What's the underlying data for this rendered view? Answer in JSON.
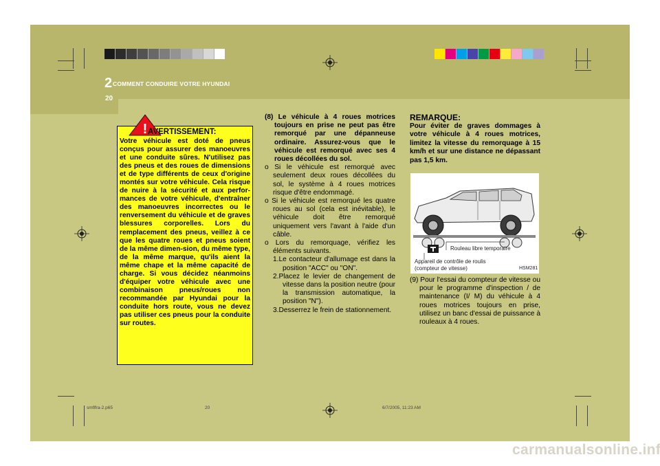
{
  "header": {
    "chapter_number": "2",
    "chapter_title": "COMMENT CONDUIRE VOTRE HYUNDAI",
    "page_number": "20"
  },
  "colors": {
    "page_background": "#c9c882",
    "header_band": "#b8b66a",
    "warning_box": "#ffff1e",
    "text": "#000000",
    "watermark": "#d8d4c8"
  },
  "swatches_gray": [
    "#1a1a1a",
    "#2c2c2c",
    "#3f3f3f",
    "#535353",
    "#686868",
    "#7d7d7d",
    "#939393",
    "#a9a9a9",
    "#c0c0c0",
    "#d8d8d8",
    "#ffffff"
  ],
  "swatches_color": [
    "#ffe600",
    "#e4007f",
    "#00a0e9",
    "#4a43a8",
    "#009944",
    "#e60012",
    "#ffec3a",
    "#f5a8c8",
    "#7fc9ef",
    "#a99fd1"
  ],
  "warning": {
    "icon": "warning-triangle-icon",
    "title": "AVERTISSEMENT:",
    "text": "Votre véhicule est doté de pneus conçus pour assurer des manoeuvres et une conduite sûres. N'utilisez pas des pneus et des roues de dimensions et de type différents de ceux d'origine montés sur votre véhicule. Cela risque de nuire à la sécurité et aux perfor-mances de votre véhicule, d'entraîner des manoeuvres incorrectes ou le renversement du véhicule et de graves blessures corporelles. Lors du remplacement des pneus, veillez à ce que les quatre roues et pneus soient de la même dimen-sion, du même type, de la même marque, qu'ils aient la même chape et la même capacité de charge. Si vous décidez néanmoins d'équiper votre véhicule avec une combinaison pneus/roues non recommandée par Hyundai pour la conduite hors route, vous ne devez pas utiliser ces pneus pour la conduite sur routes."
  },
  "step8": {
    "heading": "(8) Le véhicule à 4 roues motrices toujours en prise ne peut pas être remorqué par une dépanneuse ordinaire. Assurez-vous que le véhicule est remorqué avec ses 4 roues décollées du sol.",
    "bullets": [
      "o Si le véhicule est remorqué avec seulement deux roues décollées du sol, le système à 4 roues motrices risque d'être endommagé.",
      "o Si le véhicule est remorqué les quatre roues au sol (cela est inévitable), le véhicule doit être remorqué uniquement vers l'avant à l'aide d'un câble.",
      "o Lors du remorquage, vérifiez les éléments suivants."
    ],
    "substeps": [
      "1.Le contacteur d'allumage est dans la position \"ACC\" ou \"ON\".",
      "2.Placez le levier de changement de vitesse dans la position neutre (pour la transmission automatique, la position \"N\").",
      "3.Desserrez le frein de stationnement."
    ]
  },
  "note": {
    "title": "REMARQUE:",
    "text": "Pour éviter de graves dommages à votre véhicule à 4 roues motrices, limitez la vitesse du remorquage à 15 km/h et sur une distance ne dépassant pas 1,5 km."
  },
  "figure": {
    "label_roller": "Rouleau libre temporaire",
    "label_dyno_line1": "Appareil de contrôle de roulis",
    "label_dyno_line2": "(compteur de vitesse)",
    "code": "HSM281"
  },
  "step9": {
    "text": "(9) Pour l'essai du compteur de vitesse ou pour le programme d'inspection / de maintenance (I/ M) du véhicule à 4 roues motrices toujours en prise, utilisez un banc d'essai de puissance à rouleaux à 4 roues."
  },
  "footer": {
    "file": "smflfra-2.p65",
    "page": "20",
    "timestamp": "6/7/2005, 11:23 AM"
  },
  "watermark": "carmanualsonline.info"
}
